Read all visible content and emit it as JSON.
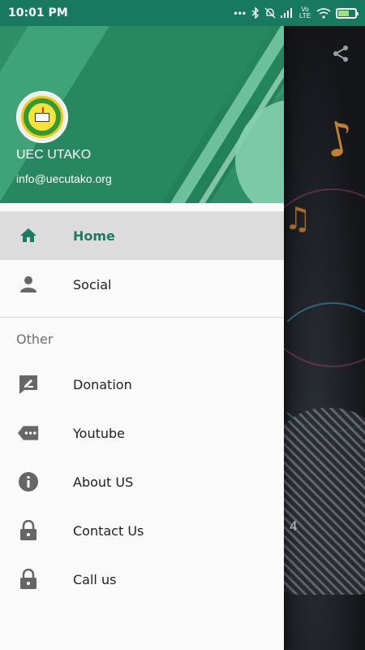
{
  "status_bar": {
    "time": "10:01 PM",
    "network": "Vo LTE"
  },
  "background": {
    "page_number": "4"
  },
  "drawer": {
    "header": {
      "name": "UEC UTAKO",
      "email": "info@uecutako.org"
    },
    "items": [
      {
        "label": "Home",
        "icon": "home-icon",
        "active": true
      },
      {
        "label": "Social",
        "icon": "person-icon",
        "active": false
      }
    ],
    "section_title": "Other",
    "other_items": [
      {
        "label": "Donation",
        "icon": "edit-note-icon"
      },
      {
        "label": "Youtube",
        "icon": "tag-icon"
      },
      {
        "label": "About US",
        "icon": "info-icon"
      },
      {
        "label": "Contact Us",
        "icon": "lock-icon"
      },
      {
        "label": "Call us",
        "icon": "lock-icon"
      }
    ]
  },
  "colors": {
    "accent": "#1f7a64",
    "status_bar": "#177a5e",
    "header": "#2e8e68"
  }
}
